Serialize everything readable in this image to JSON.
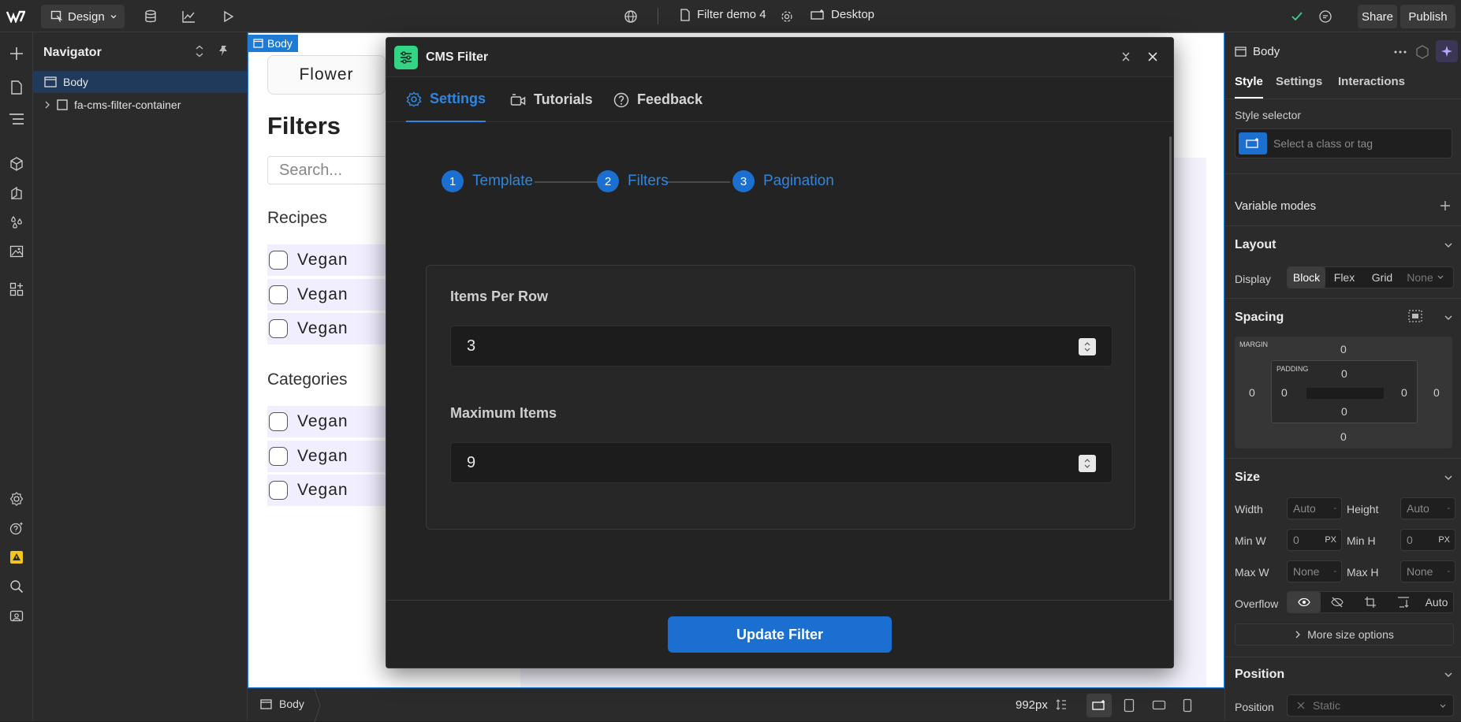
{
  "topbar": {
    "design_label": "Design",
    "page_name": "Filter demo 4",
    "device_label": "Desktop",
    "share_label": "Share",
    "publish_label": "Publish"
  },
  "navigator": {
    "title": "Navigator",
    "items": [
      {
        "label": "Body"
      },
      {
        "label": "fa-cms-filter-container"
      }
    ]
  },
  "canvas": {
    "body_tag": "Body",
    "flower_label": "Flower",
    "filters_heading": "Filters",
    "search_placeholder": "Search...",
    "recipes_heading": "Recipes",
    "recipes": [
      "Vegan",
      "Vegan",
      "Vegan"
    ],
    "categories_heading": "Categories",
    "categories": [
      "Vegan",
      "Vegan",
      "Vegan"
    ]
  },
  "canvas_bottom": {
    "breadcrumb": "Body",
    "width_label": "992px"
  },
  "modal": {
    "title": "CMS Filter",
    "tabs": [
      {
        "label": "Settings"
      },
      {
        "label": "Tutorials"
      },
      {
        "label": "Feedback"
      }
    ],
    "steps": [
      {
        "num": "1",
        "label": "Template"
      },
      {
        "num": "2",
        "label": "Filters"
      },
      {
        "num": "3",
        "label": "Pagination"
      }
    ],
    "fields": [
      {
        "label": "Items Per Row",
        "value": "3"
      },
      {
        "label": "Maximum Items",
        "value": "9"
      }
    ],
    "update_label": "Update Filter"
  },
  "panel": {
    "element_name": "Body",
    "tabs": [
      {
        "label": "Style"
      },
      {
        "label": "Settings"
      },
      {
        "label": "Interactions"
      }
    ],
    "style_selector_label": "Style selector",
    "style_selector_placeholder": "Select a class or tag",
    "variable_modes": "Variable modes",
    "layout": {
      "heading": "Layout",
      "display_label": "Display",
      "options": [
        "Block",
        "Flex",
        "Grid",
        "None"
      ]
    },
    "spacing": {
      "heading": "Spacing",
      "margin_label": "MARGIN",
      "padding_label": "PADDING",
      "margin": {
        "top": "0",
        "right": "0",
        "bottom": "0",
        "left": "0"
      },
      "padding": {
        "top": "0",
        "right": "0",
        "bottom": "0",
        "left": "0"
      }
    },
    "size": {
      "heading": "Size",
      "width_label": "Width",
      "width_val": "Auto",
      "height_label": "Height",
      "height_val": "Auto",
      "minw_label": "Min W",
      "minw_val": "0",
      "minw_unit": "PX",
      "minh_label": "Min H",
      "minh_val": "0",
      "minh_unit": "PX",
      "maxw_label": "Max W",
      "maxw_val": "None",
      "maxh_label": "Max H",
      "maxh_val": "None",
      "overflow_label": "Overflow",
      "overflow_auto": "Auto",
      "more_label": "More size options"
    },
    "position": {
      "heading": "Position",
      "label": "Position",
      "value": "Static"
    }
  },
  "colors": {
    "accent": "#1a6fd1",
    "logo_green": "#32d583",
    "publish_check": "#3ecf8e"
  }
}
